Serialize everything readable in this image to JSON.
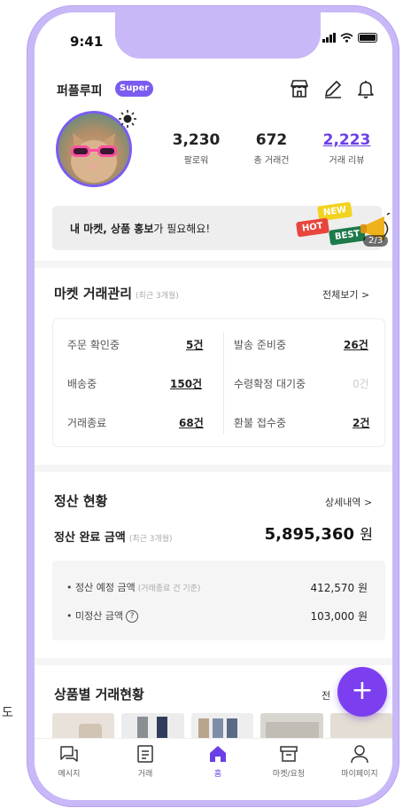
{
  "stray_text": "도",
  "status": {
    "time": "9:41"
  },
  "header": {
    "username": "퍼플루피",
    "badge": "Super"
  },
  "profile": {
    "stats": [
      {
        "value": "3,230",
        "label": "팔로워"
      },
      {
        "value": "672",
        "label": "총 거래건"
      },
      {
        "value": "2,223",
        "label": "거래 리뷰"
      }
    ]
  },
  "promo": {
    "text_bold": "내 마켓, 상품 홍보",
    "text_rest": "가 필요해요!",
    "tags": {
      "new": "NEW",
      "hot": "HOT",
      "best": "BEST"
    },
    "page": "2/3"
  },
  "market": {
    "title": "마켓 거래관리",
    "subtitle": "(최근 3개월)",
    "more": "전체보기 >",
    "rows": [
      {
        "left_label": "주문 확인중",
        "left_value": "5건",
        "right_label": "발송 준비중",
        "right_value": "26건"
      },
      {
        "left_label": "배송중",
        "left_value": "150건",
        "right_label": "수령확정 대기중",
        "right_value": "0건"
      },
      {
        "left_label": "거래종료",
        "left_value": "68건",
        "right_label": "환불 접수중",
        "right_value": "2건"
      }
    ]
  },
  "settlement": {
    "title": "정산 현황",
    "more": "상세내역 >",
    "complete_label": "정산 완료 금액",
    "complete_sub": "(최근 3개월)",
    "complete_amount": "5,895,360",
    "unit": "원",
    "expected_label": "• 정산 예정 금액",
    "expected_sub": "(거래종료 건 기준)",
    "expected_amount": "412,570 원",
    "unsettled_label": "• 미정산 금액",
    "unsettled_amount": "103,000 원"
  },
  "products": {
    "title": "상품별 거래현황",
    "more": "전"
  },
  "tabbar": [
    {
      "label": "메시지"
    },
    {
      "label": "거래"
    },
    {
      "label": "홈"
    },
    {
      "label": "마켓/요청"
    },
    {
      "label": "마이페이지"
    }
  ],
  "colors": {
    "accent": "#7b5cf0",
    "frame": "#c9b8f7",
    "review": "#6a3fe8"
  }
}
